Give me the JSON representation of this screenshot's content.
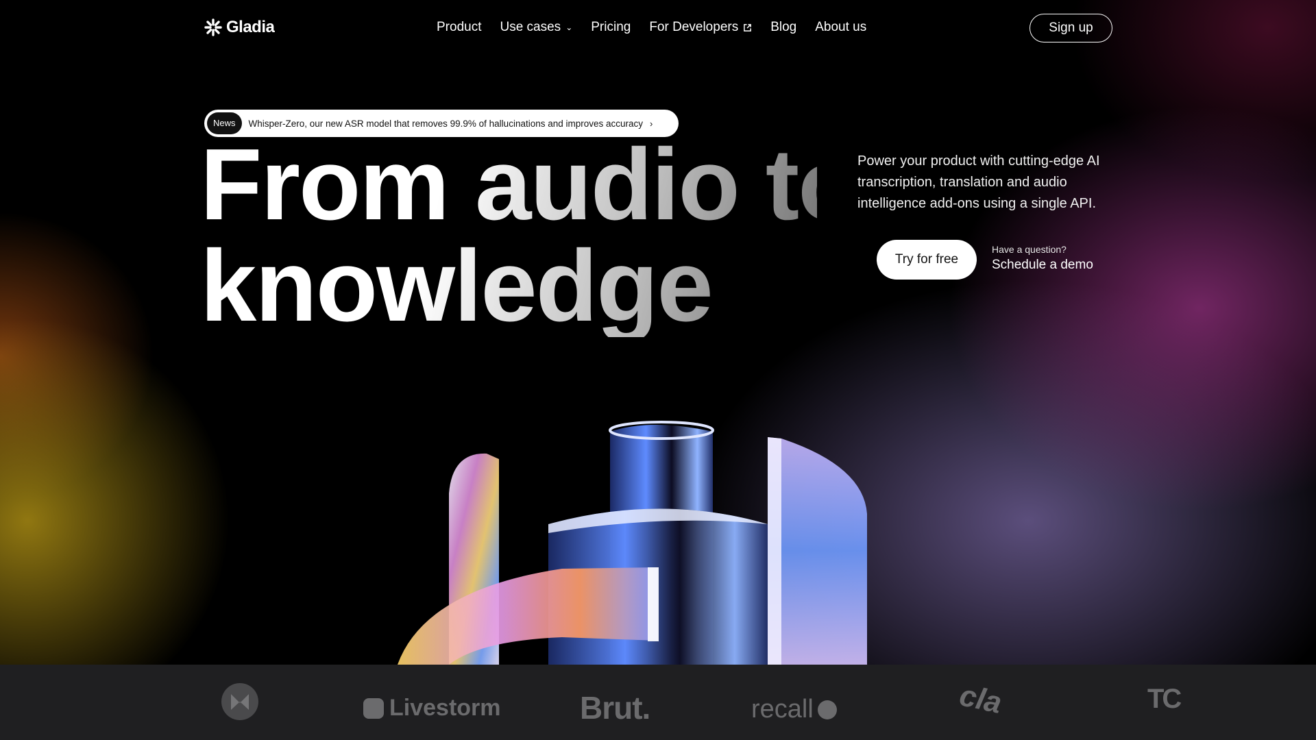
{
  "brand": {
    "name": "Gladia",
    "logo_icon": "gladia-asterisk-icon"
  },
  "nav": {
    "items": [
      {
        "label": "Product",
        "icon": null
      },
      {
        "label": "Use cases",
        "icon": "chevron-down-icon"
      },
      {
        "label": "Pricing",
        "icon": null
      },
      {
        "label": "For Developers",
        "icon": "external-link-icon"
      },
      {
        "label": "Blog",
        "icon": null
      },
      {
        "label": "About us",
        "icon": null
      }
    ],
    "signup_label": "Sign up"
  },
  "news": {
    "badge": "News",
    "text": "Whisper-Zero, our new ASR model that removes 99.9% of hallucinations and improves accuracy",
    "arrow": "›"
  },
  "hero": {
    "headline_line1": "From audio to",
    "headline_line2": "knowledge",
    "tagline": "Power your product with cutting-edge AI transcription, translation and audio intelligence add-ons using a single API.",
    "cta_primary": "Try for free",
    "question": "Have a question?",
    "cta_secondary": "Schedule a demo"
  },
  "clients": [
    {
      "name": "Mirakl-logo",
      "text": ""
    },
    {
      "name": "Livestorm",
      "text": "Livestorm"
    },
    {
      "name": "Brut",
      "text": "Brut."
    },
    {
      "name": "recall",
      "text": "recall"
    },
    {
      "name": "Claap",
      "text": "cla"
    },
    {
      "name": "TechCrunch",
      "text": "TC"
    }
  ],
  "colors": {
    "background": "#000000",
    "strip": "#1f1f21",
    "text": "#ffffff",
    "muted_logo": "#6b6b6d"
  }
}
